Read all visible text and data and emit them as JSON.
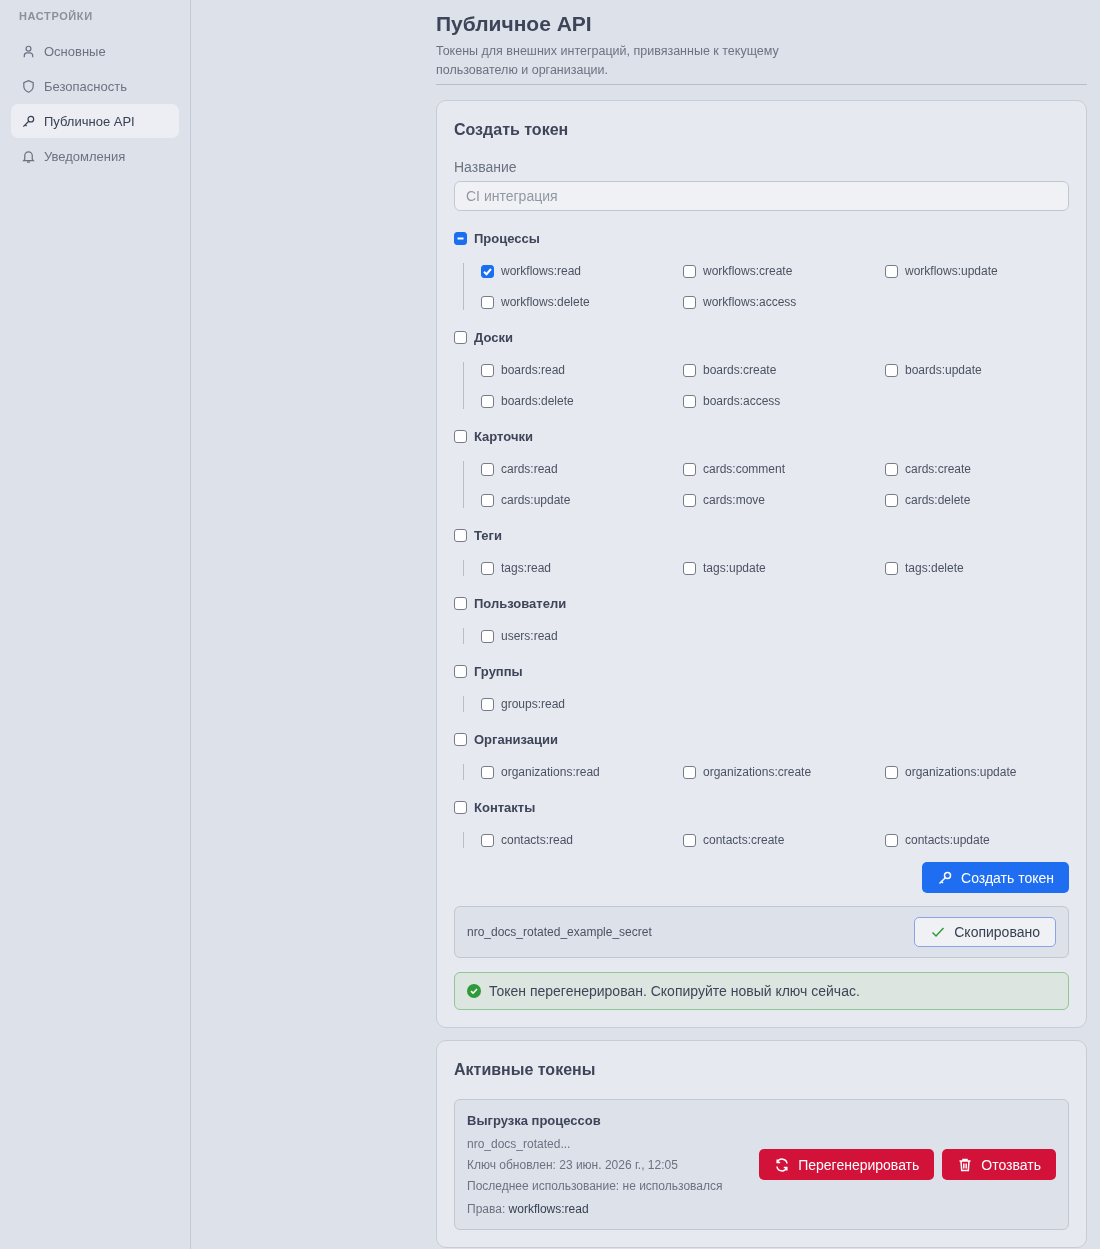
{
  "sidebar": {
    "heading": "НАСТРОЙКИ",
    "items": [
      {
        "label": "Основные",
        "selected": false
      },
      {
        "label": "Безопасность",
        "selected": false
      },
      {
        "label": "Публичное API",
        "selected": true
      },
      {
        "label": "Уведомления",
        "selected": false
      }
    ]
  },
  "page": {
    "title": "Публичное API",
    "subtitle": "Токены для внешних интеграций, привязанные к текущему пользователю и организации."
  },
  "create_token": {
    "heading": "Создать токен",
    "name_label": "Название",
    "name_placeholder": "CI интеграция",
    "groups": [
      {
        "label": "Процессы",
        "indeterminate": true,
        "scopes": [
          {
            "label": "workflows:read",
            "checked": true
          },
          {
            "label": "workflows:create",
            "checked": false
          },
          {
            "label": "workflows:update",
            "checked": false
          },
          {
            "label": "workflows:delete",
            "checked": false
          },
          {
            "label": "workflows:access",
            "checked": false
          }
        ]
      },
      {
        "label": "Доски",
        "indeterminate": false,
        "scopes": [
          {
            "label": "boards:read",
            "checked": false
          },
          {
            "label": "boards:create",
            "checked": false
          },
          {
            "label": "boards:update",
            "checked": false
          },
          {
            "label": "boards:delete",
            "checked": false
          },
          {
            "label": "boards:access",
            "checked": false
          }
        ]
      },
      {
        "label": "Карточки",
        "indeterminate": false,
        "scopes": [
          {
            "label": "cards:read",
            "checked": false
          },
          {
            "label": "cards:comment",
            "checked": false
          },
          {
            "label": "cards:create",
            "checked": false
          },
          {
            "label": "cards:update",
            "checked": false
          },
          {
            "label": "cards:move",
            "checked": false
          },
          {
            "label": "cards:delete",
            "checked": false
          }
        ]
      },
      {
        "label": "Теги",
        "indeterminate": false,
        "scopes": [
          {
            "label": "tags:read",
            "checked": false
          },
          {
            "label": "tags:update",
            "checked": false
          },
          {
            "label": "tags:delete",
            "checked": false
          }
        ]
      },
      {
        "label": "Пользователи",
        "indeterminate": false,
        "scopes": [
          {
            "label": "users:read",
            "checked": false
          }
        ]
      },
      {
        "label": "Группы",
        "indeterminate": false,
        "scopes": [
          {
            "label": "groups:read",
            "checked": false
          }
        ]
      },
      {
        "label": "Организации",
        "indeterminate": false,
        "scopes": [
          {
            "label": "organizations:read",
            "checked": false
          },
          {
            "label": "organizations:create",
            "checked": false
          },
          {
            "label": "organizations:update",
            "checked": false
          }
        ]
      },
      {
        "label": "Контакты",
        "indeterminate": false,
        "scopes": [
          {
            "label": "contacts:read",
            "checked": false
          },
          {
            "label": "contacts:create",
            "checked": false
          },
          {
            "label": "contacts:update",
            "checked": false
          }
        ]
      }
    ],
    "submit": "Создать токен",
    "secret": "nro_docs_rotated_example_secret",
    "copy_button": "Скопировано",
    "notice": "Токен перегенерирован. Скопируйте новый ключ сейчас."
  },
  "active_tokens": {
    "heading": "Активные токены",
    "tokens": [
      {
        "name": "Выгрузка процессов",
        "key": "nro_docs_rotated...",
        "updated": "Ключ обновлен: 23 июн. 2026 г., 12:05",
        "last_used": "Последнее использование: не использовался",
        "perms_label": "Права:",
        "perms_value": "workflows:read",
        "regenerate": "Перегенерировать",
        "revoke": "Отозвать"
      }
    ]
  }
}
